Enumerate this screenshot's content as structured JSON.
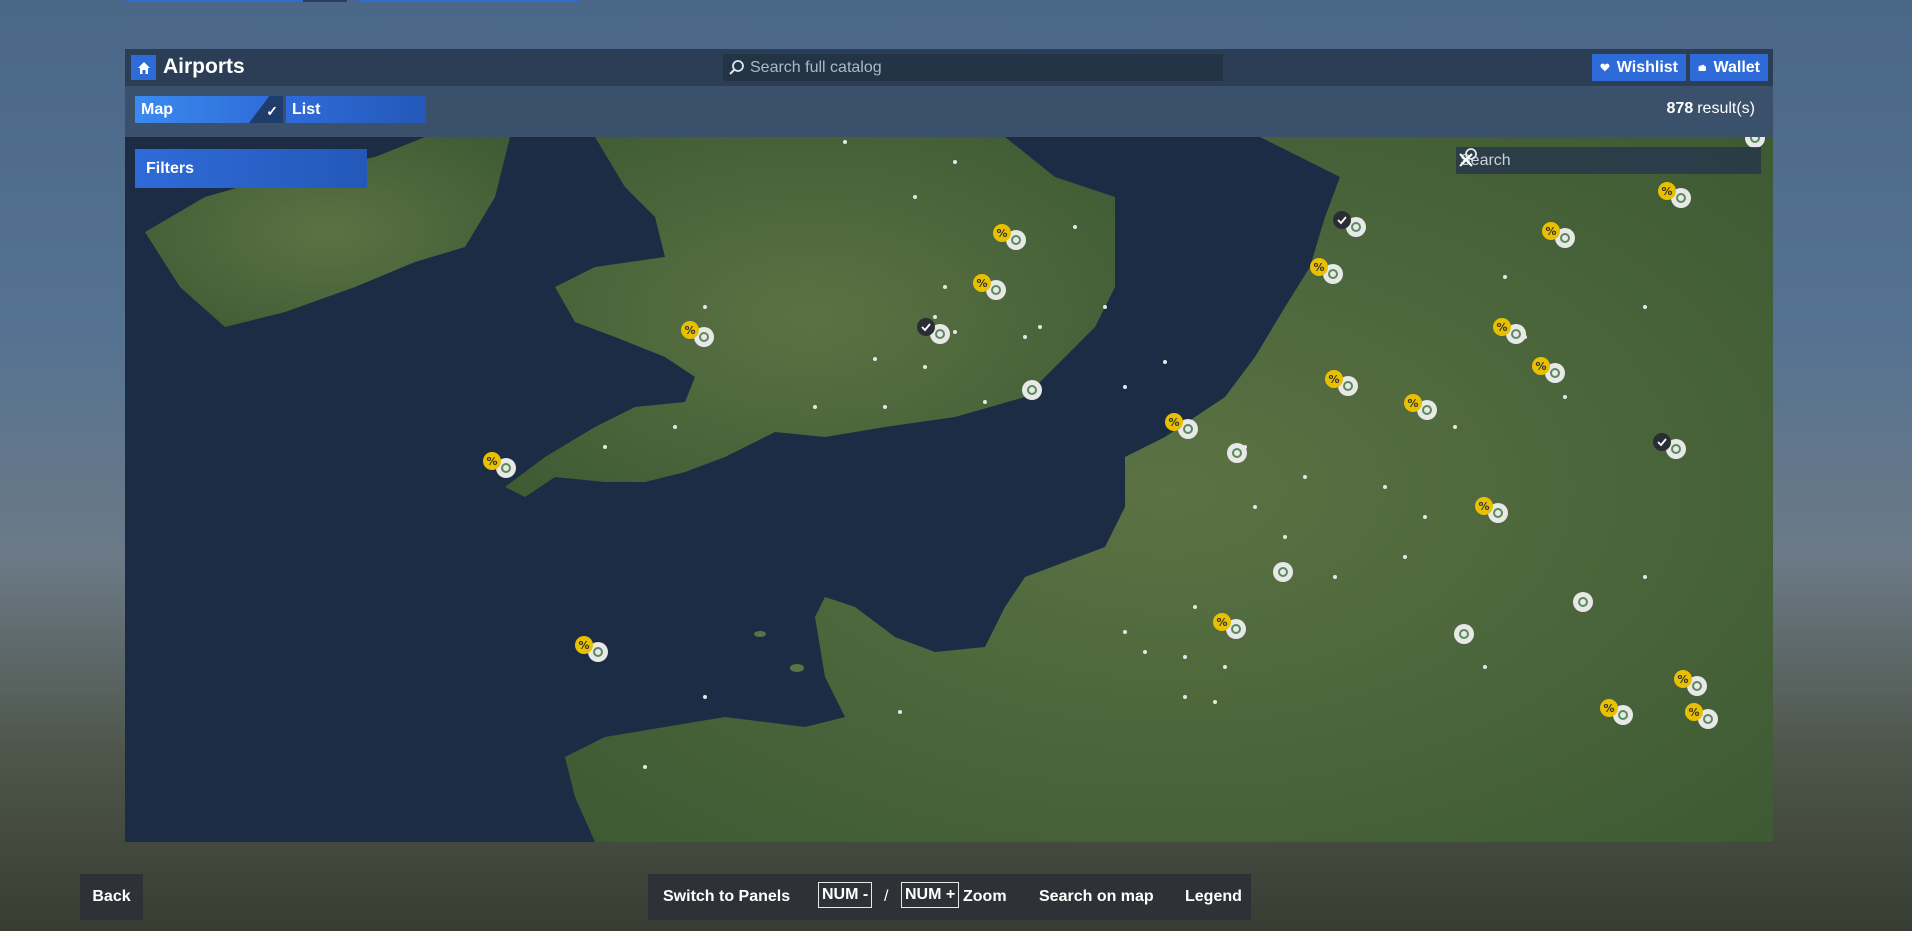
{
  "header": {
    "title": "Airports",
    "search_placeholder": "Search full catalog",
    "wishlist_label": "Wishlist",
    "wallet_label": "Wallet",
    "icons": {
      "home": "home-icon",
      "search": "search-icon",
      "wishlist": "heart-icon",
      "wallet": "wallet-icon"
    }
  },
  "view_tabs": {
    "map_label": "Map",
    "list_label": "List",
    "selected": "Map"
  },
  "results": {
    "count": "878",
    "label": "result(s)"
  },
  "map": {
    "filters_label": "Filters",
    "search_placeholder": "Search",
    "markers": {
      "legend_types": [
        "sale-airport",
        "owned-airport",
        "catalog-airport",
        "small-airfield"
      ]
    }
  },
  "footer": {
    "back_label": "Back",
    "switch_panels_label": "Switch to Panels",
    "zoom_out_key": "NUM -",
    "zoom_separator": "/",
    "zoom_in_key": "NUM +",
    "zoom_label": "Zoom",
    "search_on_map_label": "Search on map",
    "legend_label": "Legend"
  },
  "colors": {
    "accent_blue": "#2f6bd8",
    "sale_badge": "#e8c000",
    "ocean": "#1d2c45",
    "land": "#4d6a3c"
  }
}
